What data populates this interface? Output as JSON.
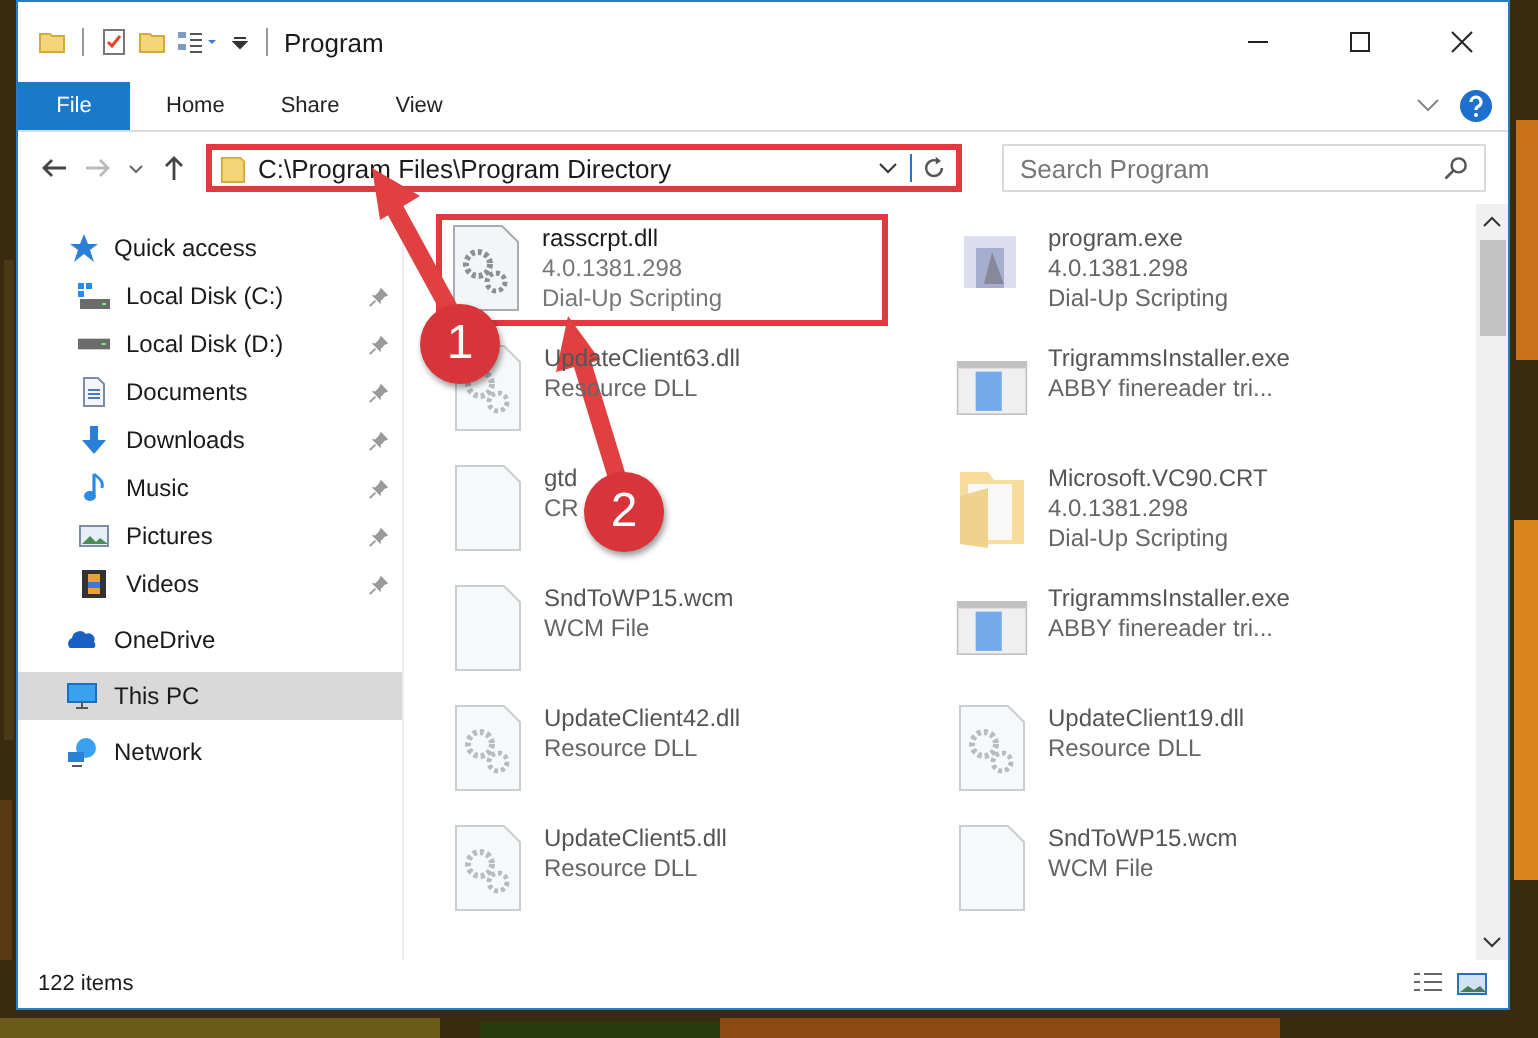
{
  "window": {
    "title": "Program"
  },
  "ribbon_tabs": [
    {
      "label": "File",
      "selected": true
    },
    {
      "label": "Home",
      "selected": false
    },
    {
      "label": "Share",
      "selected": false
    },
    {
      "label": "View",
      "selected": false
    }
  ],
  "address_bar": {
    "path": "C:\\Program Files\\Program Directory",
    "highlighted": true
  },
  "search": {
    "placeholder": "Search Program"
  },
  "sidebar": {
    "items": [
      {
        "label": "Quick access",
        "selected": false,
        "children": [
          {
            "label": "Local Disk (C:)",
            "selected": false,
            "pinned": true
          },
          {
            "label": "Local Disk (D:)",
            "selected": false,
            "pinned": true
          },
          {
            "label": "Documents",
            "selected": false,
            "pinned": true
          },
          {
            "label": "Downloads",
            "selected": false,
            "pinned": true
          },
          {
            "label": "Music",
            "selected": false,
            "pinned": true
          },
          {
            "label": "Pictures",
            "selected": false,
            "pinned": true
          },
          {
            "label": "Videos",
            "selected": false,
            "pinned": true
          }
        ]
      },
      {
        "label": "OneDrive",
        "selected": false
      },
      {
        "label": "This PC",
        "selected": true
      },
      {
        "label": "Network",
        "selected": false
      }
    ]
  },
  "files": [
    {
      "kind": "dll",
      "name": "rasscrpt.dll",
      "details": [
        "4.0.1381.298",
        "Dial-Up Scripting"
      ],
      "highlighted": true
    },
    {
      "kind": "exe",
      "name": "program.exe",
      "details": [
        "4.0.1381.298",
        "Dial-Up Scripting"
      ],
      "highlighted": false
    },
    {
      "kind": "dll",
      "name": "UpdateClient63.dll",
      "details": [
        "Resource DLL"
      ],
      "highlighted": false
    },
    {
      "kind": "installer",
      "name": "TrigrammsInstaller.exe",
      "details": [
        "ABBY finereader tri..."
      ],
      "highlighted": false
    },
    {
      "kind": "file",
      "name": "gtd",
      "details": [
        "CR"
      ],
      "highlighted": false
    },
    {
      "kind": "folder",
      "name": "Microsoft.VC90.CRT",
      "details": [
        "4.0.1381.298",
        "Dial-Up Scripting"
      ],
      "highlighted": false
    },
    {
      "kind": "file",
      "name": "SndToWP15.wcm",
      "details": [
        "WCM File"
      ],
      "highlighted": false
    },
    {
      "kind": "installer",
      "name": "TrigrammsInstaller.exe",
      "details": [
        "ABBY finereader tri..."
      ],
      "highlighted": false
    },
    {
      "kind": "dll",
      "name": "UpdateClient42.dll",
      "details": [
        "Resource DLL"
      ],
      "highlighted": false
    },
    {
      "kind": "dll",
      "name": "UpdateClient19.dll",
      "details": [
        "Resource DLL"
      ],
      "highlighted": false
    },
    {
      "kind": "dll",
      "name": "UpdateClient5.dll",
      "details": [
        "Resource DLL"
      ],
      "highlighted": false
    },
    {
      "kind": "file",
      "name": "SndToWP15.wcm",
      "details": [
        "WCM File"
      ],
      "highlighted": false
    }
  ],
  "callouts": [
    {
      "number": "1"
    },
    {
      "number": "2"
    }
  ],
  "status_bar": {
    "count": "122 items"
  }
}
